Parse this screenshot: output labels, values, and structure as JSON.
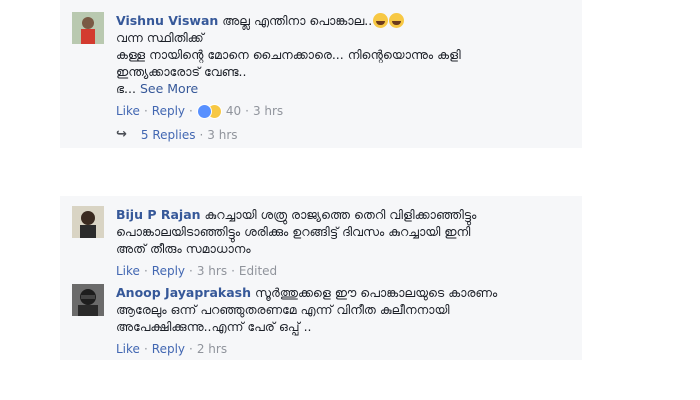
{
  "comments": [
    {
      "author": "Vishnu Viswan",
      "lines": [
        "അല്ല എന്തിനാ പൊങ്കാല..",
        "വന്ന സ്ഥിതിക്ക്",
        "കള്ള നായിന്റെ മോനെ ചൈനക്കാരെ... നിന്റെയൊന്നും കളി",
        "ഇന്ത്യക്കാരോട് വേണ്ട..",
        "ഭ..."
      ],
      "see_more": "See More",
      "like": "Like",
      "reply": "Reply",
      "reaction_count": "40",
      "time": "3 hrs",
      "replies_label": "5 Replies",
      "replies_time": "3 hrs"
    },
    {
      "author": "Biju P Rajan",
      "lines": [
        "കുറച്ചായി ശത്രു രാജ്യത്തെ തെറി വിളിക്കാഞ്ഞിട്ടും",
        "പൊങ്കാലയിടാഞ്ഞിട്ടും ശരിക്കും ഉറങ്ങിട്ട് ദിവസം കുറച്ചായി ഇനി",
        "അത് തീരും സമാധാനം"
      ],
      "like": "Like",
      "reply": "Reply",
      "time": "3 hrs",
      "edited": "Edited"
    },
    {
      "author": "Anoop Jayaprakash",
      "lines": [
        "സൂർത്തുക്കളെ ഈ പൊങ്കാലയുടെ കാരണം",
        "ആരേലും ഒന്ന് പറഞ്ഞുതരണമേ എന്ന് വിനീത കുലീനനായി",
        "അപേക്ഷിക്കുന്നു..എന്ന് പേര് ഒപ്പ് .."
      ],
      "like": "Like",
      "reply": "Reply",
      "time": "2 hrs"
    }
  ],
  "colors": {
    "link": "#365899",
    "action": "#4267b2",
    "muted": "#90949c",
    "card_bg": "#f6f7f9"
  }
}
